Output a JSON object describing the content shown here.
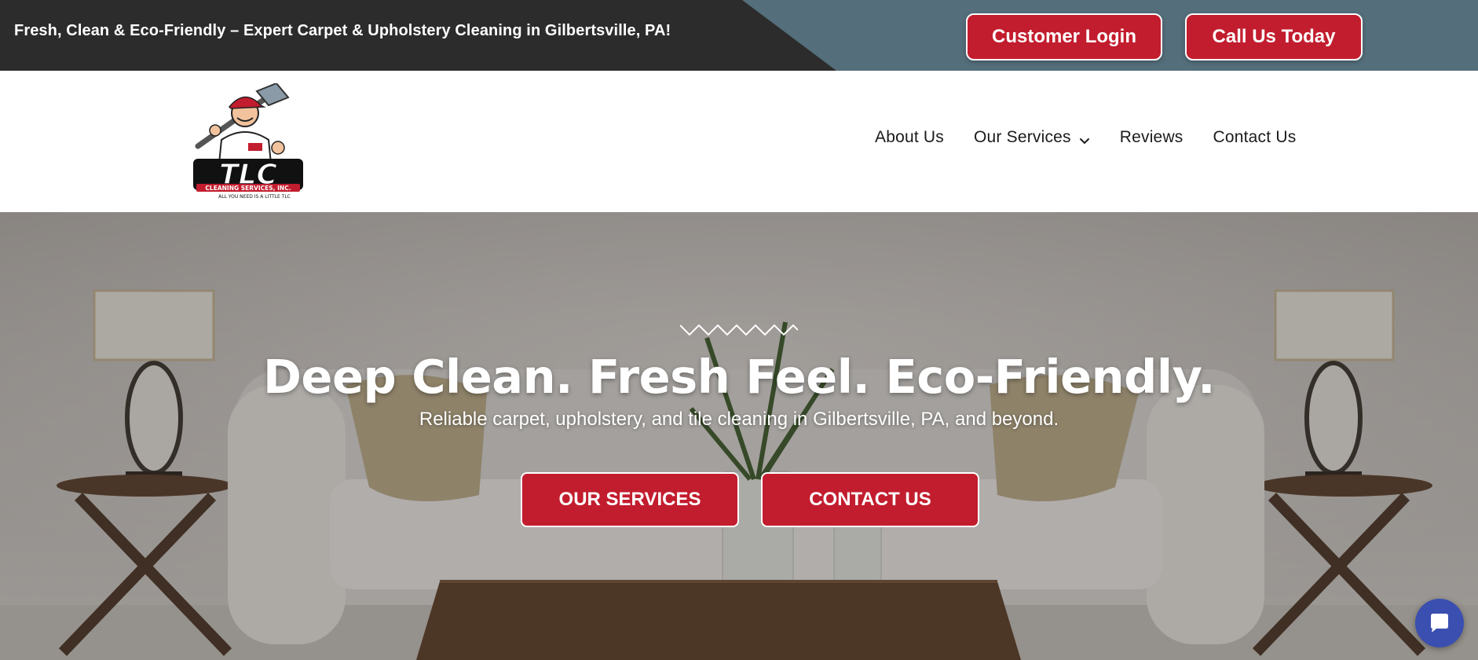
{
  "topbar": {
    "tagline": "Fresh, Clean & Eco-Friendly – Expert Carpet & Upholstery Cleaning in Gilbertsville, PA!",
    "login_label": "Customer Login",
    "call_label": "Call Us Today"
  },
  "logo": {
    "letters": "TLC",
    "company": "CLEANING SERVICES, INC.",
    "slogan": "ALL YOU NEED IS A LITTLE TLC"
  },
  "nav": {
    "items": [
      {
        "label": "About Us"
      },
      {
        "label": "Our Services",
        "has_dropdown": true
      },
      {
        "label": "Reviews"
      },
      {
        "label": "Contact Us"
      }
    ]
  },
  "hero": {
    "title": "Deep Clean. Fresh Feel. Eco-Friendly.",
    "subtitle": "Reliable carpet, upholstery, and tile cleaning in Gilbertsville, PA, and beyond.",
    "services_label": "OUR SERVICES",
    "contact_label": "CONTACT US"
  },
  "icons": {
    "chevron": "chevron-down-icon",
    "chat": "chat-bubble-icon"
  },
  "colors": {
    "brand_red": "#c21d2e",
    "topbar_dark": "#2c2c2c",
    "topbar_slate": "#546e7b",
    "chat_blue": "#3a4fb0"
  }
}
